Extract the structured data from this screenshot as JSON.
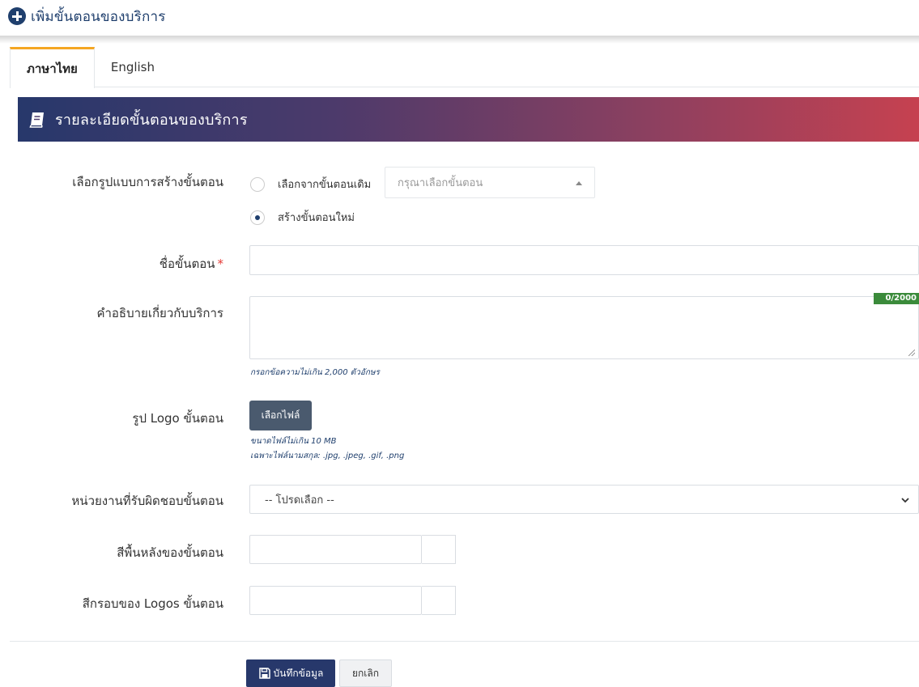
{
  "header": {
    "title": "เพิ่มขั้นตอนของบริการ",
    "icon": "plus-circle-icon"
  },
  "tabs": [
    {
      "label": "ภาษาไทย",
      "active": true
    },
    {
      "label": "English",
      "active": false
    }
  ],
  "section": {
    "title": "รายละเอียดขั้นตอนของบริการ",
    "icon": "book-icon"
  },
  "form": {
    "creation_mode": {
      "label": "เลือกรูปแบบการสร้างขั้นตอน",
      "options": [
        {
          "label": "เลือกจากขั้นตอนเดิม",
          "checked": false
        },
        {
          "label": "สร้างขั้นตอนใหม่",
          "checked": true
        }
      ],
      "select_placeholder": "กรุณาเลือกขั้นตอน"
    },
    "step_name": {
      "label": "ชื่อขั้นตอน",
      "required_mark": "*",
      "value": ""
    },
    "description": {
      "label": "คำอธิบายเกี่ยวกับบริการ",
      "value": "",
      "counter": "0/2000",
      "hint": "กรอกข้อความไม่เกิน 2,000 ตัวอักษร"
    },
    "logo": {
      "label": "รูป Logo ขั้นตอน",
      "button": "เลือกไฟล์",
      "hint_size": "ขนาดไฟล์ไม่เกิน 10 MB",
      "hint_types": "เฉพาะไฟล์นามสกุล: .jpg, .jpeg, .gif, .png"
    },
    "department": {
      "label": "หน่วยงานที่รับผิดชอบขั้นตอน",
      "selected": "-- โปรดเลือก --"
    },
    "bg_color": {
      "label": "สีพื้นหลังของขั้นตอน",
      "value": ""
    },
    "border_color": {
      "label": "สีกรอบของ Logos ขั้นตอน",
      "value": ""
    }
  },
  "actions": {
    "save_label": "บันทึกข้อมูล",
    "cancel_label": "ยกเลิก"
  },
  "colors": {
    "primary": "#1f3f6d",
    "tab_accent": "#f5a623",
    "banner_start": "#27386b",
    "banner_end": "#c64150",
    "counter_bg": "#3b8b3b",
    "required": "#e53935"
  }
}
